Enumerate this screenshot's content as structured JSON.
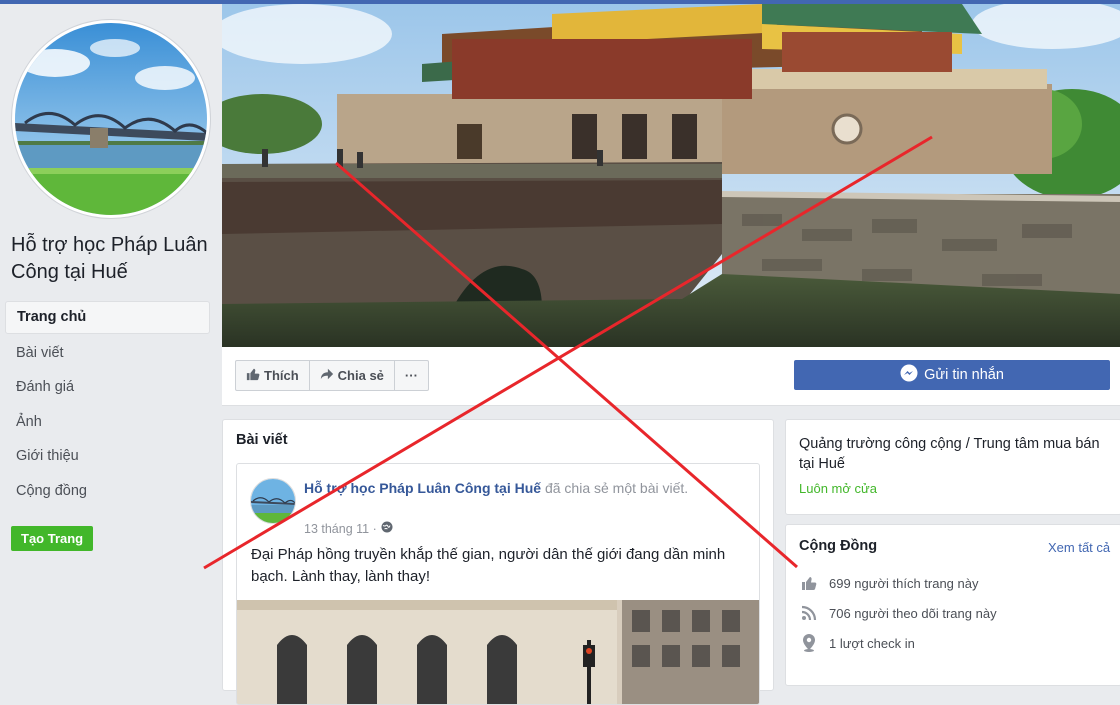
{
  "sidebar": {
    "page_name": "Hỗ trợ học Pháp Luân Công tại Huế",
    "nav": [
      {
        "label": "Trang chủ"
      },
      {
        "label": "Bài viết"
      },
      {
        "label": "Đánh giá"
      },
      {
        "label": "Ảnh"
      },
      {
        "label": "Giới thiệu"
      },
      {
        "label": "Cộng đồng"
      }
    ],
    "create_page": "Tạo Trang"
  },
  "actions": {
    "like": "Thích",
    "share": "Chia sẻ",
    "more": "···",
    "message": "Gửi tin nhắn"
  },
  "posts": {
    "title": "Bài viết",
    "post": {
      "author": "Hỗ trợ học Pháp Luân Công tại Huế",
      "action": "đã chia sẻ một bài viết.",
      "date": "13 tháng 11 ·",
      "text": "Đại Pháp hồng truyền khắp thế gian, người dân thế giới đang dần minh bạch. Lành thay, lành thay!"
    }
  },
  "info": {
    "category": "Quảng trường công cộng / Trung tâm mua bán tại Huế",
    "open": "Luôn mở cửa"
  },
  "community": {
    "title": "Cộng Đồng",
    "see_all": "Xem tất cả",
    "likes": "699 người thích trang này",
    "follows": "706 người theo dõi trang này",
    "checkins": "1 lượt check in"
  },
  "colors": {
    "brand": "#4267b2",
    "green": "#42b72a",
    "cross": "#e8262b"
  }
}
